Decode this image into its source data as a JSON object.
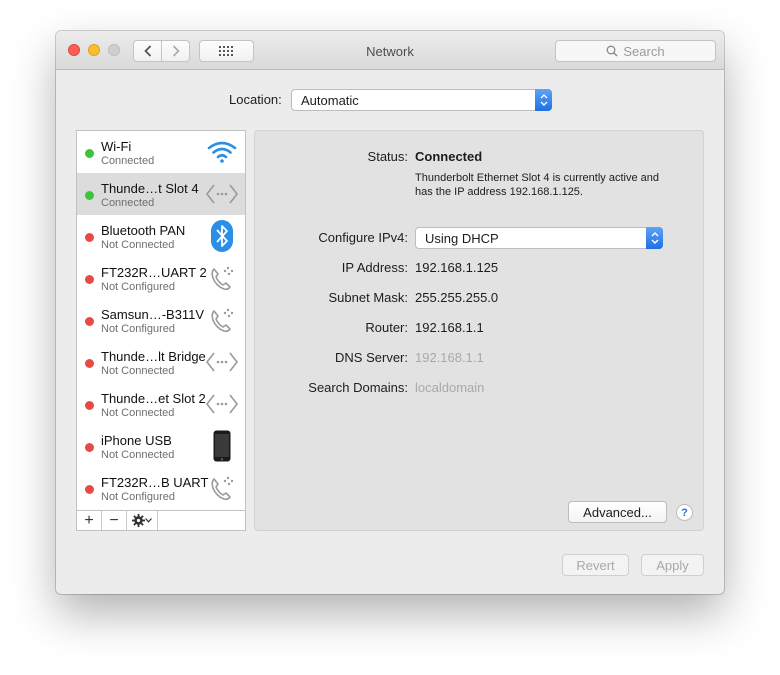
{
  "window": {
    "title": "Network"
  },
  "toolbar": {
    "search_placeholder": "Search"
  },
  "location": {
    "label": "Location:",
    "value": "Automatic"
  },
  "services": [
    {
      "name": "Wi-Fi",
      "status": "Connected",
      "dot_color": "#3cc43c",
      "icon": "wifi-icon"
    },
    {
      "name": "Thunde…t Slot 4",
      "status": "Connected",
      "dot_color": "#3cc43c",
      "icon": "ethernet-icon",
      "selected": true
    },
    {
      "name": "Bluetooth PAN",
      "status": "Not Connected",
      "dot_color": "#e84a45",
      "icon": "bluetooth-icon"
    },
    {
      "name": "FT232R…UART 2",
      "status": "Not Configured",
      "dot_color": "#e84a45",
      "icon": "phone-icon"
    },
    {
      "name": "Samsun…-B311V",
      "status": "Not Configured",
      "dot_color": "#e84a45",
      "icon": "phone-icon"
    },
    {
      "name": "Thunde…lt Bridge",
      "status": "Not Connected",
      "dot_color": "#e84a45",
      "icon": "ethernet-icon"
    },
    {
      "name": "Thunde…et Slot 2",
      "status": "Not Connected",
      "dot_color": "#e84a45",
      "icon": "ethernet-icon"
    },
    {
      "name": "iPhone USB",
      "status": "Not Connected",
      "dot_color": "#e84a45",
      "icon": "iphone-icon"
    },
    {
      "name": "FT232R…B UART",
      "status": "Not Configured",
      "dot_color": "#e84a45",
      "icon": "phone-icon"
    }
  ],
  "list_toolbar": {
    "add": "+",
    "remove": "−",
    "gear_arrow": "⌄"
  },
  "detail": {
    "status_label": "Status:",
    "status_value": "Connected",
    "status_desc": "Thunderbolt Ethernet Slot 4 is currently active and has the IP address 192.168.1.125.",
    "configure_label": "Configure IPv4:",
    "configure_value": "Using DHCP",
    "ip_label": "IP Address:",
    "ip_value": "192.168.1.125",
    "subnet_label": "Subnet Mask:",
    "subnet_value": "255.255.255.0",
    "router_label": "Router:",
    "router_value": "192.168.1.1",
    "dns_label": "DNS Server:",
    "dns_value": "192.168.1.1",
    "search_label": "Search Domains:",
    "search_value": "localdomain",
    "advanced_label": "Advanced...",
    "help_label": "?"
  },
  "footer": {
    "revert_label": "Revert",
    "apply_label": "Apply"
  },
  "colors": {
    "accent": "#2a7bf2",
    "connected": "#3cc43c",
    "disconnected": "#e84a45"
  }
}
